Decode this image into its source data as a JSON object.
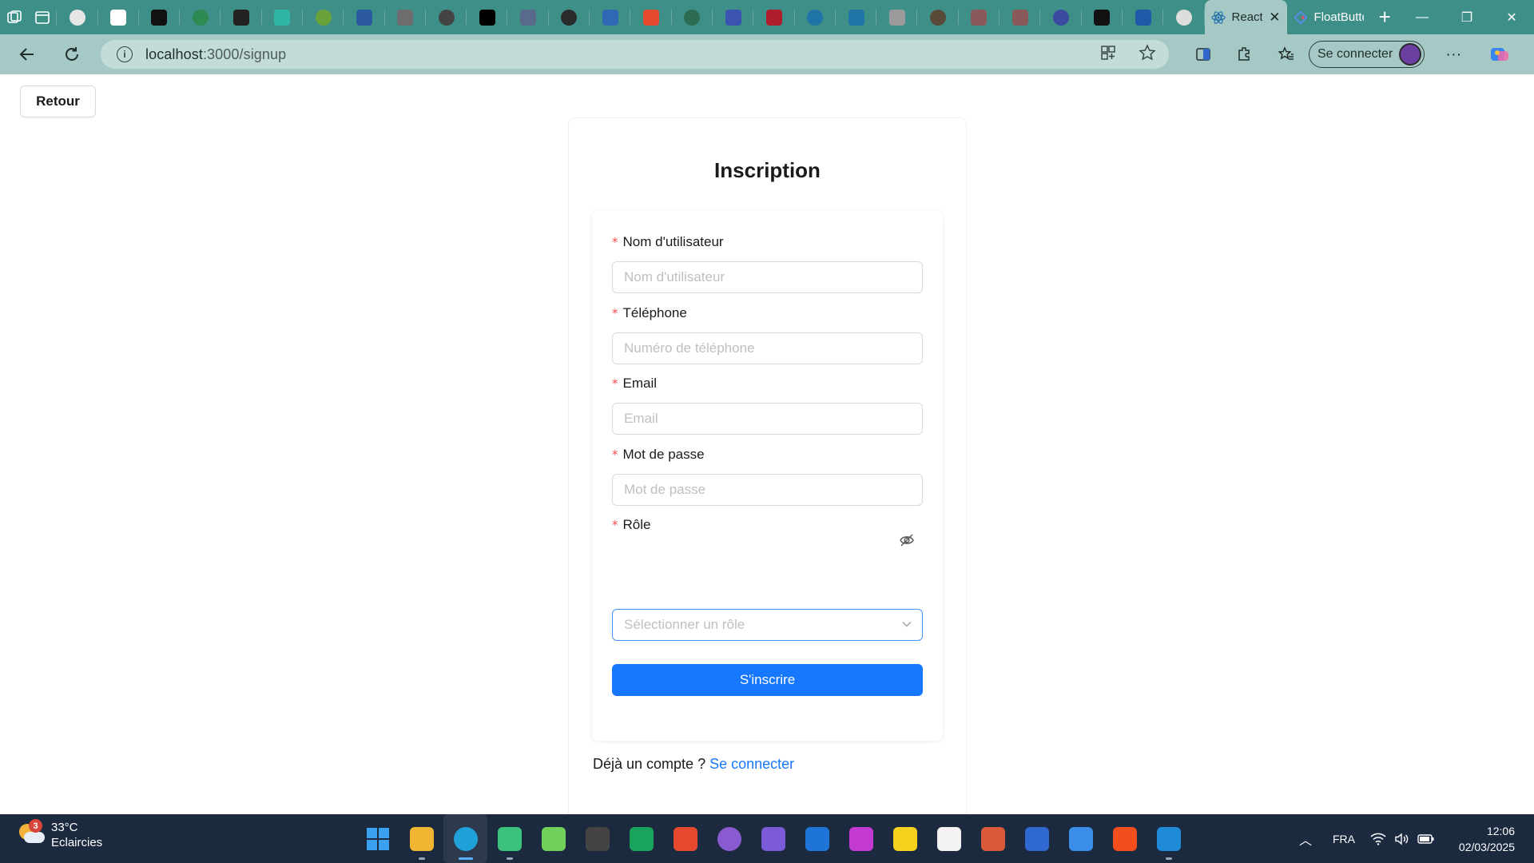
{
  "browser": {
    "tabs": [
      {
        "name": "tab-icon-1",
        "color": "#e6e6e6"
      },
      {
        "name": "tab-icon-2",
        "color": "#ffffff"
      },
      {
        "name": "tab-icon-3",
        "color": "#111111"
      },
      {
        "name": "tab-icon-4",
        "color": "#2d8a52"
      },
      {
        "name": "tab-icon-5",
        "color": "#222222"
      },
      {
        "name": "tab-icon-6",
        "color": "#2fb5a5"
      },
      {
        "name": "tab-icon-7",
        "color": "#6aa23a"
      },
      {
        "name": "tab-icon-8",
        "color": "#2c5aa0"
      },
      {
        "name": "tab-icon-9",
        "color": "#6d6d6d"
      },
      {
        "name": "tab-icon-10",
        "color": "#444444"
      },
      {
        "name": "tab-icon-11",
        "color": "#000000"
      },
      {
        "name": "tab-icon-12",
        "color": "#5a6a8a"
      },
      {
        "name": "tab-icon-13",
        "color": "#2a2a2a"
      },
      {
        "name": "tab-icon-14",
        "color": "#2f68b5"
      },
      {
        "name": "tab-icon-15",
        "color": "#e64a2e"
      },
      {
        "name": "tab-icon-16",
        "color": "#2d6b52"
      },
      {
        "name": "tab-icon-17",
        "color": "#3b54b0"
      },
      {
        "name": "tab-icon-18",
        "color": "#b01e2e"
      },
      {
        "name": "tab-icon-19",
        "color": "#1f74a8"
      },
      {
        "name": "tab-icon-20",
        "color": "#1f74a8"
      },
      {
        "name": "tab-icon-21",
        "color": "#9a9a9a"
      },
      {
        "name": "tab-icon-22",
        "color": "#5a4a3a"
      },
      {
        "name": "tab-icon-23",
        "color": "#8a5a5a"
      },
      {
        "name": "tab-icon-24",
        "color": "#8a5a5a"
      },
      {
        "name": "tab-icon-25",
        "color": "#3a4aa0"
      },
      {
        "name": "tab-icon-26",
        "color": "#111111"
      },
      {
        "name": "tab-icon-27",
        "color": "#1f5aa8"
      },
      {
        "name": "tab-icon-28",
        "color": "#dddddd"
      }
    ],
    "active_tab_title": "React",
    "second_tab_title": "FloatButton",
    "new_tab_label": "+",
    "url_host": "localhost",
    "url_rest": ":3000/signup",
    "signin_label": "Se connecter"
  },
  "page": {
    "back_label": "Retour",
    "title": "Inscription",
    "fields": {
      "username": {
        "label": "Nom d'utilisateur",
        "placeholder": "Nom d'utilisateur"
      },
      "phone": {
        "label": "Téléphone",
        "placeholder": "Numéro de téléphone"
      },
      "email": {
        "label": "Email",
        "placeholder": "Email"
      },
      "password": {
        "label": "Mot de passe",
        "placeholder": "Mot de passe"
      },
      "role": {
        "label": "Rôle",
        "placeholder": "Sélectionner un rôle"
      }
    },
    "required_mark": "*",
    "submit_label": "S'inscrire",
    "login_prompt": "Déjà un compte ?",
    "login_link": "Se connecter"
  },
  "taskbar": {
    "weather": {
      "badge": "3",
      "temperature": "33°C",
      "condition": "Eclaircies"
    },
    "apps": [
      {
        "name": "start-icon",
        "color": "#3aa0f0"
      },
      {
        "name": "file-explorer-icon",
        "color": "#f2b632"
      },
      {
        "name": "edge-icon",
        "color": "#1fa0d8"
      },
      {
        "name": "app-icon-4",
        "color": "#3cc27a"
      },
      {
        "name": "app-icon-5",
        "color": "#6fd15a"
      },
      {
        "name": "app-icon-6",
        "color": "#444444"
      },
      {
        "name": "app-icon-7",
        "color": "#1aa35a"
      },
      {
        "name": "app-icon-8",
        "color": "#e64a2e"
      },
      {
        "name": "github-icon",
        "color": "#8a5ad0"
      },
      {
        "name": "app-icon-10",
        "color": "#7b5ad8"
      },
      {
        "name": "trello-icon",
        "color": "#1f74d8"
      },
      {
        "name": "app-icon-12",
        "color": "#c23ad0"
      },
      {
        "name": "miro-icon",
        "color": "#f6d21f"
      },
      {
        "name": "app-icon-14",
        "color": "#f2f2f2"
      },
      {
        "name": "app-icon-15",
        "color": "#d85a3a"
      },
      {
        "name": "app-icon-16",
        "color": "#2f68d0"
      },
      {
        "name": "app-icon-17",
        "color": "#3a8ee8"
      },
      {
        "name": "figma-icon",
        "color": "#f24e1e"
      },
      {
        "name": "vscode-icon",
        "color": "#1f8ad8"
      }
    ],
    "language": "FRA",
    "time": "12:06",
    "date": "02/03/2025"
  },
  "colors": {
    "accent": "#1677ff",
    "required": "#ff4d4f",
    "browser_frame": "#3f8f89",
    "browser_toolbar": "#a6c9c6",
    "taskbar": "#1c2a3f"
  }
}
